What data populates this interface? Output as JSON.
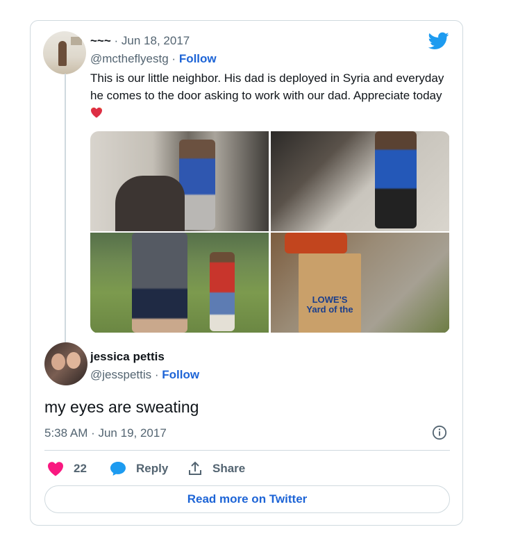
{
  "colors": {
    "accent": "#1d64d6",
    "twitter_blue": "#1d9bf0",
    "like_pink": "#f91880",
    "muted": "#536471",
    "border": "#cfd9de"
  },
  "quoted_tweet": {
    "author_name": "~~~",
    "date": "Jun 18, 2017",
    "handle": "@mctheflyestg",
    "follow_label": "Follow",
    "text": "This is our little neighbor. His dad is deployed in Syria and everyday he comes to the door asking to work with our dad. Appreciate today",
    "emoji": "heart-emoji",
    "photos": [
      {
        "icon": "photo-boy-at-door"
      },
      {
        "icon": "photo-boy-on-porch"
      },
      {
        "icon": "photo-man-and-boy-in-yard"
      },
      {
        "icon": "photo-lowes-yard-bag",
        "caption": "LOWE'S Yard of the"
      }
    ]
  },
  "reply": {
    "author_name": "jessica pettis",
    "handle": "@jesspettis",
    "follow_label": "Follow",
    "text": "my eyes are sweating",
    "timestamp": "5:38 AM · Jun 19, 2017"
  },
  "actions": {
    "likes": "22",
    "reply_label": "Reply",
    "share_label": "Share"
  },
  "read_more_label": "Read more on Twitter",
  "icons": [
    "twitter-bird-icon",
    "info-icon",
    "heart-icon",
    "reply-bubble-icon",
    "share-icon"
  ]
}
